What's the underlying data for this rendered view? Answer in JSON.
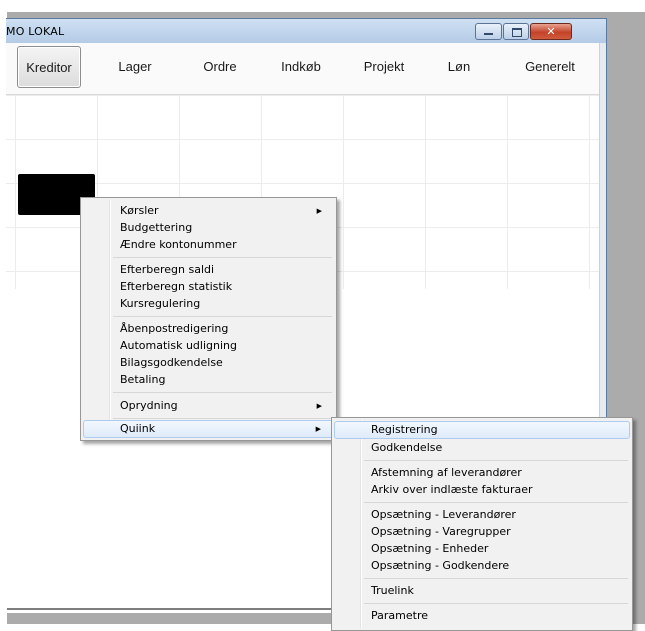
{
  "window": {
    "title": "MO LOKAL",
    "close_glyph": "✕"
  },
  "tabs": [
    {
      "label": "Kreditor",
      "active": true
    },
    {
      "label": "Lager"
    },
    {
      "label": "Ordre"
    },
    {
      "label": "Indkøb"
    },
    {
      "label": "Projekt"
    },
    {
      "label": "Løn"
    },
    {
      "label": "Generelt"
    }
  ],
  "context_menu": {
    "items": [
      {
        "label": "Kørsler",
        "submenu": true
      },
      {
        "label": "Budgettering"
      },
      {
        "label": "Ændre kontonummer"
      },
      {
        "label": "Efterberegn saldi"
      },
      {
        "label": "Efterberegn statistik"
      },
      {
        "label": "Kursregulering"
      },
      {
        "label": "Åbenpostredigering"
      },
      {
        "label": "Automatisk udligning"
      },
      {
        "label": "Bilagsgodkendelse"
      },
      {
        "label": "Betaling"
      },
      {
        "label": "Oprydning",
        "submenu": true
      },
      {
        "label": "Quiink",
        "submenu": true,
        "highlighted": true
      }
    ]
  },
  "submenu": {
    "items": [
      {
        "label": "Registrering",
        "highlighted": true
      },
      {
        "label": "Godkendelse"
      },
      {
        "label": "Afstemning af leverandører"
      },
      {
        "label": "Arkiv over indlæste fakturaer"
      },
      {
        "label": "Opsætning - Leverandører"
      },
      {
        "label": "Opsætning - Varegrupper"
      },
      {
        "label": "Opsætning - Enheder"
      },
      {
        "label": "Opsætning - Godkendere"
      },
      {
        "label": "Truelink"
      },
      {
        "label": "Parametre"
      }
    ]
  },
  "icons": {
    "submenu_arrow": "▶"
  },
  "colors": {
    "menu_background": "#f1f1f1",
    "menu_highlight": "#dfebfa",
    "window_frame": "#9eb9d8",
    "close_button": "#c4432a"
  }
}
